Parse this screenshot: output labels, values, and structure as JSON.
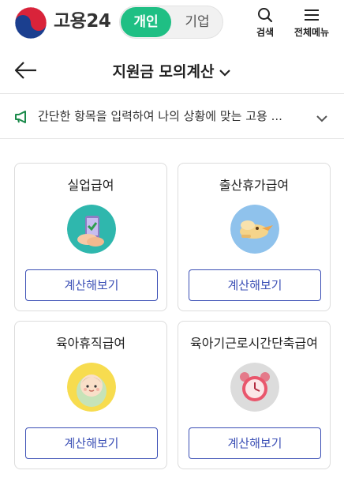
{
  "header": {
    "logo_text": "고용24",
    "toggle": {
      "active": "개인",
      "inactive": "기업"
    },
    "search_label": "검색",
    "menu_label": "전체메뉴",
    "accent_color": "#1fbf84"
  },
  "titlebar": {
    "title": "지원금 모의계산"
  },
  "notice": {
    "text": "간단한 항목을 입력하여 나의 상황에 맞는 고용 ..."
  },
  "cards": [
    {
      "title": "실업급여",
      "button": "계산해보기",
      "icon": "phone-check-illustration"
    },
    {
      "title": "출산휴가급여",
      "button": "계산해보기",
      "icon": "stork-illustration"
    },
    {
      "title": "육아휴직급여",
      "button": "계산해보기",
      "icon": "baby-illustration"
    },
    {
      "title": "육아기근로시간단축급여",
      "button": "계산해보기",
      "icon": "alarm-clock-illustration"
    }
  ],
  "colors": {
    "button_border": "#3b4fb5",
    "card_border": "#dcdcdc"
  }
}
